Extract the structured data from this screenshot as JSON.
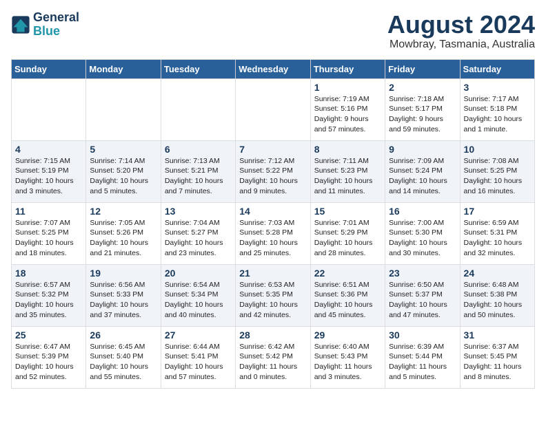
{
  "header": {
    "logo_line1": "General",
    "logo_line2": "Blue",
    "main_title": "August 2024",
    "subtitle": "Mowbray, Tasmania, Australia"
  },
  "days_of_week": [
    "Sunday",
    "Monday",
    "Tuesday",
    "Wednesday",
    "Thursday",
    "Friday",
    "Saturday"
  ],
  "weeks": [
    [
      {
        "day": "",
        "info": ""
      },
      {
        "day": "",
        "info": ""
      },
      {
        "day": "",
        "info": ""
      },
      {
        "day": "",
        "info": ""
      },
      {
        "day": "1",
        "info": "Sunrise: 7:19 AM\nSunset: 5:16 PM\nDaylight: 9 hours\nand 57 minutes."
      },
      {
        "day": "2",
        "info": "Sunrise: 7:18 AM\nSunset: 5:17 PM\nDaylight: 9 hours\nand 59 minutes."
      },
      {
        "day": "3",
        "info": "Sunrise: 7:17 AM\nSunset: 5:18 PM\nDaylight: 10 hours\nand 1 minute."
      }
    ],
    [
      {
        "day": "4",
        "info": "Sunrise: 7:15 AM\nSunset: 5:19 PM\nDaylight: 10 hours\nand 3 minutes."
      },
      {
        "day": "5",
        "info": "Sunrise: 7:14 AM\nSunset: 5:20 PM\nDaylight: 10 hours\nand 5 minutes."
      },
      {
        "day": "6",
        "info": "Sunrise: 7:13 AM\nSunset: 5:21 PM\nDaylight: 10 hours\nand 7 minutes."
      },
      {
        "day": "7",
        "info": "Sunrise: 7:12 AM\nSunset: 5:22 PM\nDaylight: 10 hours\nand 9 minutes."
      },
      {
        "day": "8",
        "info": "Sunrise: 7:11 AM\nSunset: 5:23 PM\nDaylight: 10 hours\nand 11 minutes."
      },
      {
        "day": "9",
        "info": "Sunrise: 7:09 AM\nSunset: 5:24 PM\nDaylight: 10 hours\nand 14 minutes."
      },
      {
        "day": "10",
        "info": "Sunrise: 7:08 AM\nSunset: 5:25 PM\nDaylight: 10 hours\nand 16 minutes."
      }
    ],
    [
      {
        "day": "11",
        "info": "Sunrise: 7:07 AM\nSunset: 5:25 PM\nDaylight: 10 hours\nand 18 minutes."
      },
      {
        "day": "12",
        "info": "Sunrise: 7:05 AM\nSunset: 5:26 PM\nDaylight: 10 hours\nand 21 minutes."
      },
      {
        "day": "13",
        "info": "Sunrise: 7:04 AM\nSunset: 5:27 PM\nDaylight: 10 hours\nand 23 minutes."
      },
      {
        "day": "14",
        "info": "Sunrise: 7:03 AM\nSunset: 5:28 PM\nDaylight: 10 hours\nand 25 minutes."
      },
      {
        "day": "15",
        "info": "Sunrise: 7:01 AM\nSunset: 5:29 PM\nDaylight: 10 hours\nand 28 minutes."
      },
      {
        "day": "16",
        "info": "Sunrise: 7:00 AM\nSunset: 5:30 PM\nDaylight: 10 hours\nand 30 minutes."
      },
      {
        "day": "17",
        "info": "Sunrise: 6:59 AM\nSunset: 5:31 PM\nDaylight: 10 hours\nand 32 minutes."
      }
    ],
    [
      {
        "day": "18",
        "info": "Sunrise: 6:57 AM\nSunset: 5:32 PM\nDaylight: 10 hours\nand 35 minutes."
      },
      {
        "day": "19",
        "info": "Sunrise: 6:56 AM\nSunset: 5:33 PM\nDaylight: 10 hours\nand 37 minutes."
      },
      {
        "day": "20",
        "info": "Sunrise: 6:54 AM\nSunset: 5:34 PM\nDaylight: 10 hours\nand 40 minutes."
      },
      {
        "day": "21",
        "info": "Sunrise: 6:53 AM\nSunset: 5:35 PM\nDaylight: 10 hours\nand 42 minutes."
      },
      {
        "day": "22",
        "info": "Sunrise: 6:51 AM\nSunset: 5:36 PM\nDaylight: 10 hours\nand 45 minutes."
      },
      {
        "day": "23",
        "info": "Sunrise: 6:50 AM\nSunset: 5:37 PM\nDaylight: 10 hours\nand 47 minutes."
      },
      {
        "day": "24",
        "info": "Sunrise: 6:48 AM\nSunset: 5:38 PM\nDaylight: 10 hours\nand 50 minutes."
      }
    ],
    [
      {
        "day": "25",
        "info": "Sunrise: 6:47 AM\nSunset: 5:39 PM\nDaylight: 10 hours\nand 52 minutes."
      },
      {
        "day": "26",
        "info": "Sunrise: 6:45 AM\nSunset: 5:40 PM\nDaylight: 10 hours\nand 55 minutes."
      },
      {
        "day": "27",
        "info": "Sunrise: 6:44 AM\nSunset: 5:41 PM\nDaylight: 10 hours\nand 57 minutes."
      },
      {
        "day": "28",
        "info": "Sunrise: 6:42 AM\nSunset: 5:42 PM\nDaylight: 11 hours\nand 0 minutes."
      },
      {
        "day": "29",
        "info": "Sunrise: 6:40 AM\nSunset: 5:43 PM\nDaylight: 11 hours\nand 3 minutes."
      },
      {
        "day": "30",
        "info": "Sunrise: 6:39 AM\nSunset: 5:44 PM\nDaylight: 11 hours\nand 5 minutes."
      },
      {
        "day": "31",
        "info": "Sunrise: 6:37 AM\nSunset: 5:45 PM\nDaylight: 11 hours\nand 8 minutes."
      }
    ]
  ]
}
